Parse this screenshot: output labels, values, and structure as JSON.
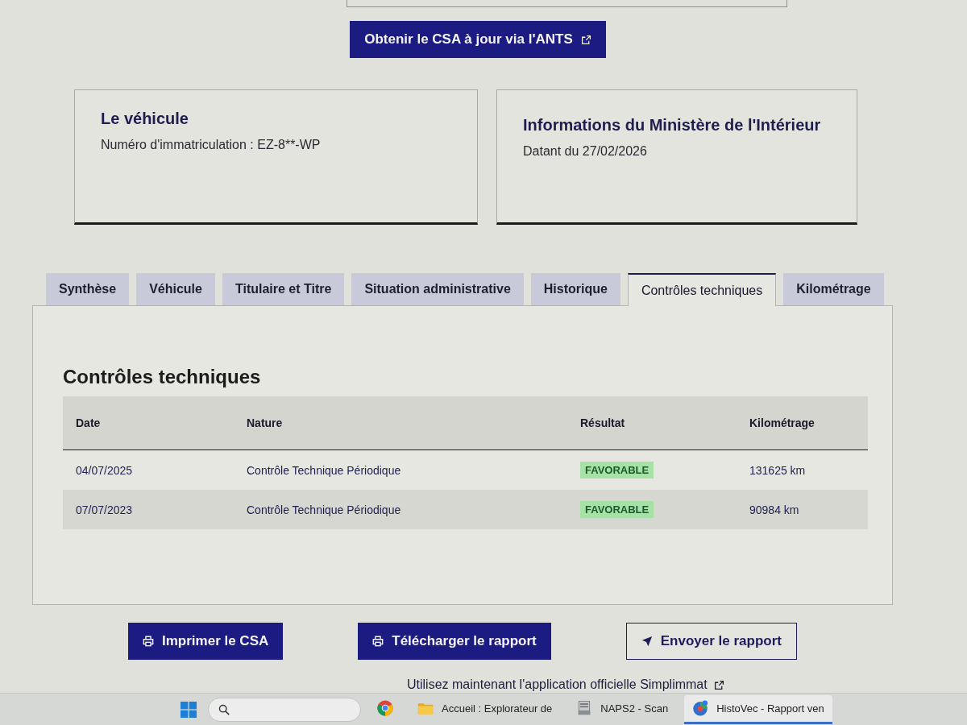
{
  "top_button": {
    "label": "Obtenir le CSA à jour via l'ANTS"
  },
  "cards": [
    {
      "title": "Le véhicule",
      "text": "Numéro d'immatriculation : EZ-8**-WP"
    },
    {
      "title": "Informations du Ministère de l'Intérieur",
      "text": "Datant du 27/02/2026"
    }
  ],
  "tabs": [
    {
      "label": "Synthèse",
      "selected": false
    },
    {
      "label": "Véhicule",
      "selected": false
    },
    {
      "label": "Titulaire et Titre",
      "selected": false
    },
    {
      "label": "Situation administrative",
      "selected": false
    },
    {
      "label": "Historique",
      "selected": false
    },
    {
      "label": "Contrôles techniques",
      "selected": true
    },
    {
      "label": "Kilométrage",
      "selected": false
    }
  ],
  "panel": {
    "title": "Contrôles techniques",
    "table": {
      "columns": [
        "Date",
        "Nature",
        "Résultat",
        "Kilométrage"
      ],
      "rows": [
        {
          "date": "04/07/2025",
          "nature": "Contrôle Technique Périodique",
          "result": "FAVORABLE",
          "mileage": "131625 km"
        },
        {
          "date": "07/07/2023",
          "nature": "Contrôle Technique Périodique",
          "result": "FAVORABLE",
          "mileage": "90984 km"
        }
      ]
    }
  },
  "actions": [
    {
      "label": "Imprimer le CSA",
      "kind": "print"
    },
    {
      "label": "Télécharger le rapport",
      "kind": "print"
    },
    {
      "label": "Envoyer le rapport",
      "kind": "send"
    }
  ],
  "footer_link": {
    "label": "Utilisez maintenant l'application officielle Simplimmat"
  },
  "taskbar": {
    "apps": [
      {
        "kind": "browser",
        "selected": false
      },
      {
        "kind": "explorer",
        "label": "Accueil : Explorateur de",
        "selected": false
      },
      {
        "kind": "scanner",
        "label": "NAPS2 - Scan",
        "selected": false
      },
      {
        "kind": "webapp",
        "label": "HistoVec - Rapport ven",
        "selected": true
      }
    ]
  }
}
